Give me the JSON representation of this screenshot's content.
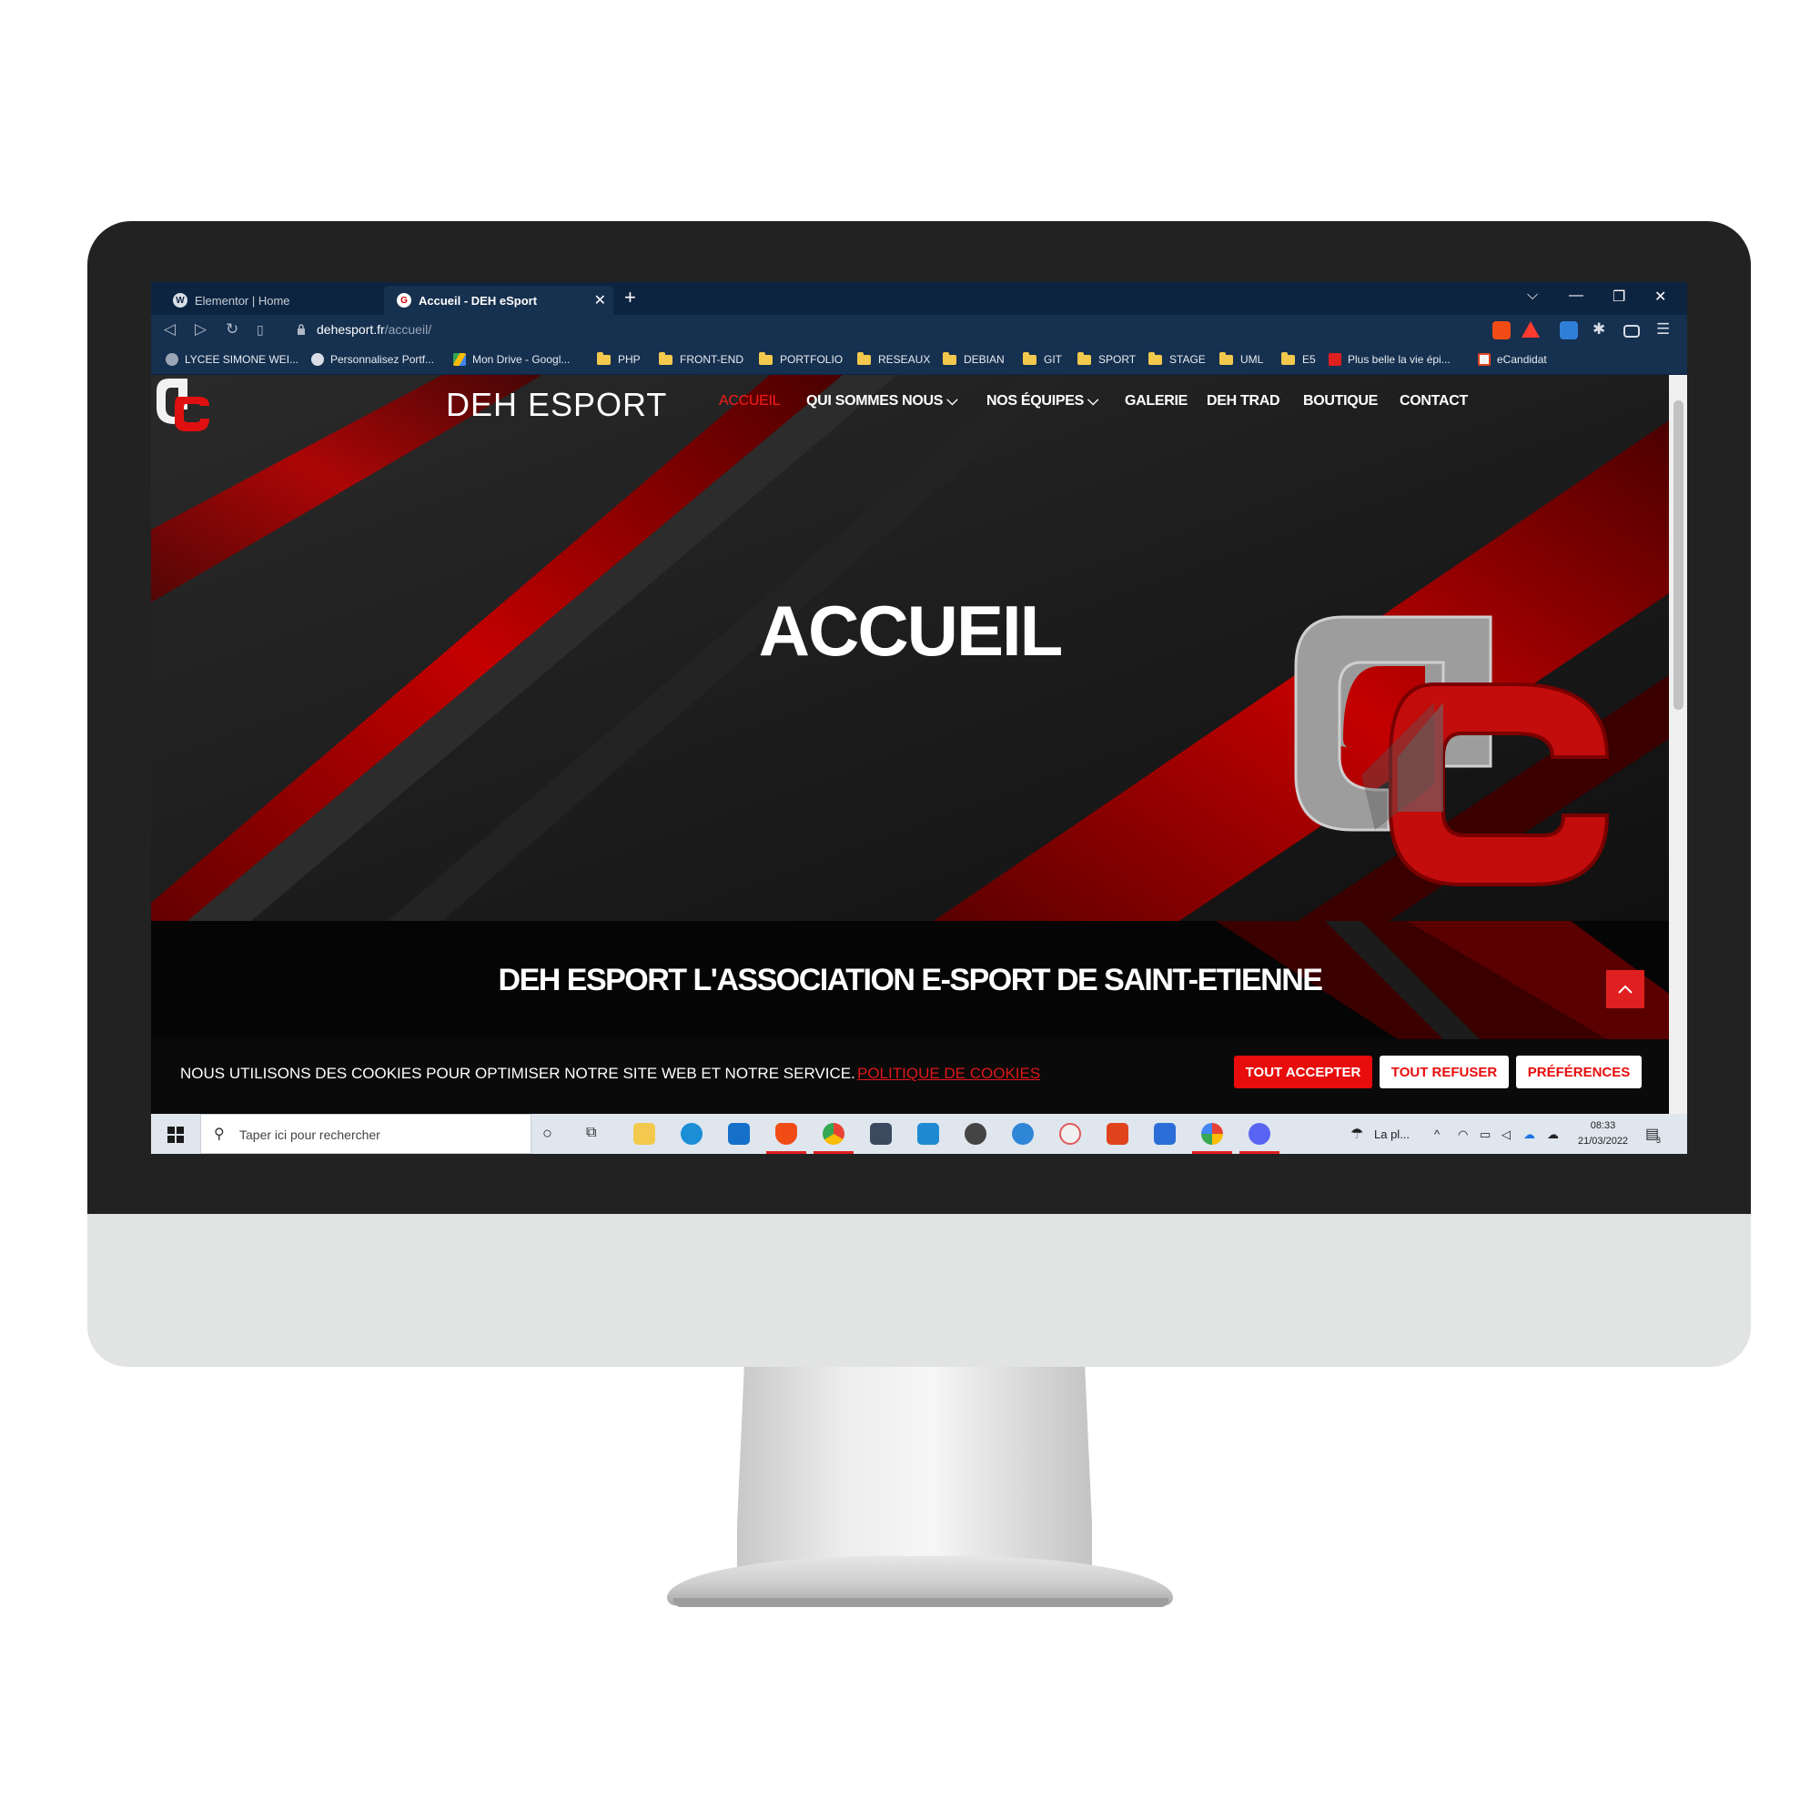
{
  "browser": {
    "tabs": [
      {
        "label": "Elementor | Home",
        "active": false
      },
      {
        "label": "Accueil - DEH eSport",
        "active": true
      }
    ],
    "new_tab": "+",
    "url_host": "dehesport.fr",
    "url_path": "/accueil/",
    "window_controls": {
      "menu": "⌵",
      "minimize": "—",
      "restore": "❐",
      "close": "✕"
    },
    "bookmarks": [
      {
        "label": "LYCEE SIMONE WEI...",
        "icon": "site-icon"
      },
      {
        "label": "Personnalisez Portf...",
        "icon": "wordpress-icon"
      },
      {
        "label": "Mon Drive - Googl...",
        "icon": "google-drive-icon"
      },
      {
        "label": "PHP",
        "icon": "folder-icon"
      },
      {
        "label": "FRONT-END",
        "icon": "folder-icon"
      },
      {
        "label": "PORTFOLIO",
        "icon": "folder-icon"
      },
      {
        "label": "RESEAUX",
        "icon": "folder-icon"
      },
      {
        "label": "DEBIAN",
        "icon": "folder-icon"
      },
      {
        "label": "GIT",
        "icon": "folder-icon"
      },
      {
        "label": "SPORT",
        "icon": "folder-icon"
      },
      {
        "label": "STAGE",
        "icon": "folder-icon"
      },
      {
        "label": "UML",
        "icon": "folder-icon"
      },
      {
        "label": "E5",
        "icon": "folder-icon"
      },
      {
        "label": "Plus belle la vie épi...",
        "icon": "site-icon"
      },
      {
        "label": "eCandidat",
        "icon": "site-icon"
      }
    ]
  },
  "site": {
    "brand": "DEH ESPORT",
    "nav": [
      {
        "label": "ACCUEIL",
        "active": true
      },
      {
        "label": "QUI SOMMES NOUS ⌵",
        "active": false
      },
      {
        "label": "NOS ÉQUIPES ⌵",
        "active": false
      },
      {
        "label": "GALERIE",
        "active": false
      },
      {
        "label": "DEH TRAD",
        "active": false
      },
      {
        "label": "BOUTIQUE",
        "active": false
      },
      {
        "label": "CONTACT",
        "active": false
      }
    ],
    "hero_title": "ACCUEIL",
    "band_title": "DEH ESPORT L'ASSOCIATION E-SPORT DE SAINT-ETIENNE",
    "cookie": {
      "text": "NOUS UTILISONS DES COOKIES POUR OPTIMISER NOTRE SITE WEB ET NOTRE SERVICE.",
      "link": "POLITIQUE DE COOKIES",
      "accept": "TOUT ACCEPTER",
      "refuse": "TOUT REFUSER",
      "prefs": "PRÉFÉRENCES"
    },
    "colors": {
      "accent": "#e80c0c",
      "dark": "#141414"
    }
  },
  "taskbar": {
    "search_placeholder": "Taper ici pour rechercher",
    "weather": "La pl...",
    "time": "08:33",
    "date": "21/03/2022",
    "notifications": "3"
  }
}
